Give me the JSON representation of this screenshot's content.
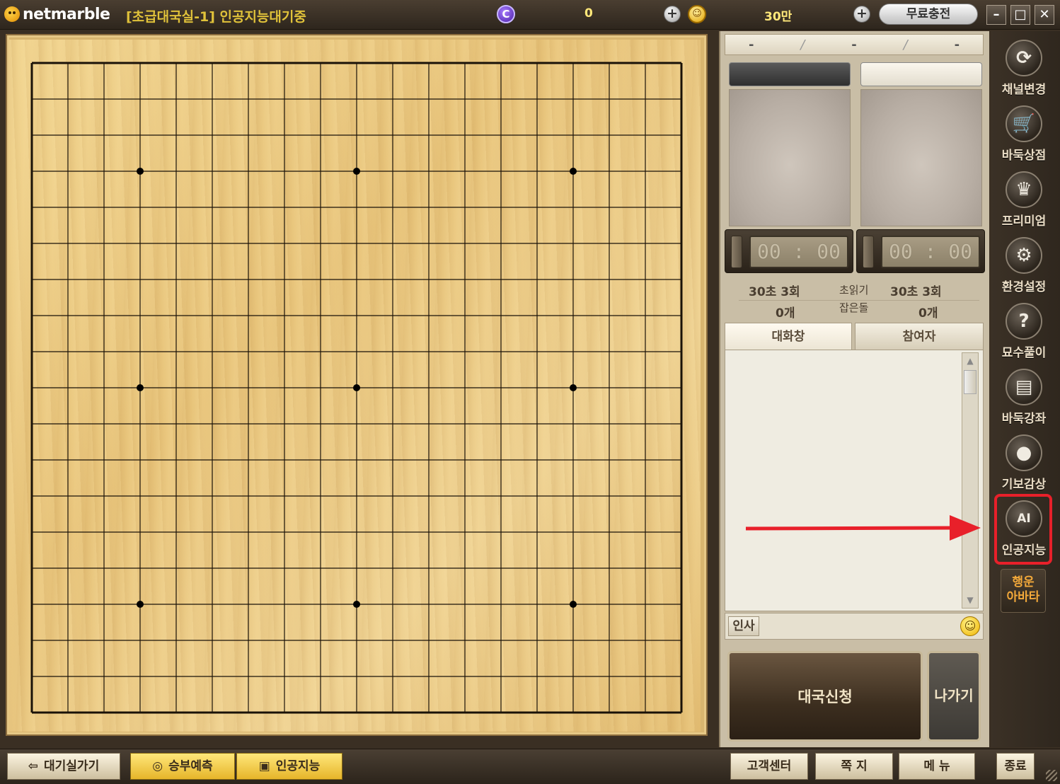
{
  "titlebar": {
    "brand": "netmarble",
    "room_title": "[초급대국실-1] 인공지능대기중",
    "c_coin_symbol": "C",
    "c_balance": "0",
    "gold_balance": "30만",
    "free_charge_label": "무료충전",
    "minimize_label": "–",
    "maximize_label": "□",
    "close_label": "✕"
  },
  "board": {
    "size": 19,
    "star_points": [
      [
        3,
        3
      ],
      [
        3,
        9
      ],
      [
        3,
        15
      ],
      [
        9,
        3
      ],
      [
        9,
        9
      ],
      [
        9,
        15
      ],
      [
        15,
        3
      ],
      [
        15,
        9
      ],
      [
        15,
        15
      ]
    ]
  },
  "score": {
    "left": "-",
    "sep1": "/",
    "middle": "-",
    "sep2": "/",
    "right": "-"
  },
  "players": {
    "left": {
      "timer": "00 : 00",
      "byoyomi": "30초  3회",
      "captured": "0개"
    },
    "right": {
      "timer": "00 : 00",
      "byoyomi": "30초  3회",
      "captured": "0개"
    },
    "byoyomi_label": "초읽기",
    "captured_label": "잡은돌"
  },
  "chat": {
    "tabs": [
      {
        "label": "대화창"
      },
      {
        "label": "참여자"
      }
    ],
    "greet_label": "인사",
    "input_value": "",
    "emoji_icon": "☺"
  },
  "actions": {
    "apply_label": "대국신청",
    "exit_label": "나가기"
  },
  "sidebar": {
    "items": [
      {
        "label": "채널변경",
        "icon": "refresh-icon",
        "glyph": "⟳"
      },
      {
        "label": "바둑상점",
        "icon": "cart-icon",
        "glyph": "🛒"
      },
      {
        "label": "프리미엄",
        "icon": "premium-icon",
        "glyph": "♛"
      },
      {
        "label": "환경설정",
        "icon": "gear-icon",
        "glyph": "⚙"
      },
      {
        "label": "묘수풀이",
        "icon": "question-icon",
        "glyph": "?"
      },
      {
        "label": "바둑강좌",
        "icon": "book-icon",
        "glyph": "▤"
      },
      {
        "label": "기보감상",
        "icon": "stones-icon",
        "glyph": "●"
      },
      {
        "label": "인공지능",
        "icon": "ai-head-icon",
        "glyph": "AI"
      }
    ],
    "luck_label_1": "행운",
    "luck_label_2": "아바타"
  },
  "bottom": {
    "waiting_room": "대기실가기",
    "waiting_icon": "⇦",
    "prediction": "승부예측",
    "prediction_icon": "◎",
    "ai": "인공지능",
    "ai_icon": "▣",
    "customer_center": "고객센터",
    "memo": "쪽 지",
    "menu": "메 뉴",
    "quit": "종료"
  },
  "colors": {
    "accent_red": "#e8202a",
    "board_wood": "#e8c47a",
    "title_yellow": "#e0c23a"
  }
}
